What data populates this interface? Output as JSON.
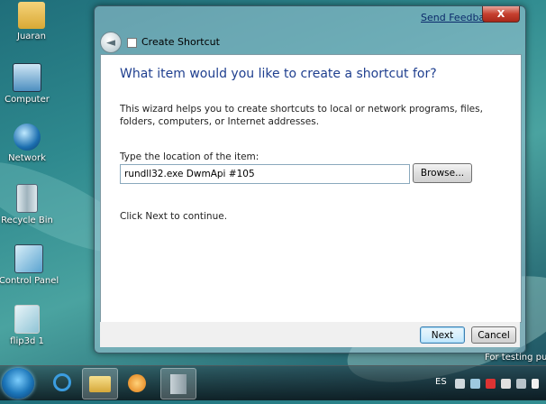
{
  "desktop": {
    "icons": [
      {
        "label": "Juaran"
      },
      {
        "label": "Computer"
      },
      {
        "label": "Network"
      },
      {
        "label": "Recycle Bin"
      },
      {
        "label": "Control Panel"
      },
      {
        "label": "flip3d 1"
      }
    ]
  },
  "window": {
    "title": "Create Shortcut",
    "send_feedback": "Send Feedback",
    "close_glyph": "X",
    "back_glyph": "◄"
  },
  "wizard": {
    "heading": "What item would you like to create a shortcut for?",
    "description": "This wizard helps you to create shortcuts to local or network programs, files, folders, computers, or Internet addresses.",
    "location_label": "Type the location of the item:",
    "location_value": "rundll32.exe DwmApi #105",
    "browse_label": "Browse...",
    "continue_text": "Click Next to continue.",
    "next_label": "Next",
    "cancel_label": "Cancel"
  },
  "taskbar": {
    "language": "ES",
    "notice": "For testing pur"
  },
  "colors": {
    "heading": "#1f3f8f",
    "link": "#0b2a6b",
    "close": "#c6402f"
  }
}
